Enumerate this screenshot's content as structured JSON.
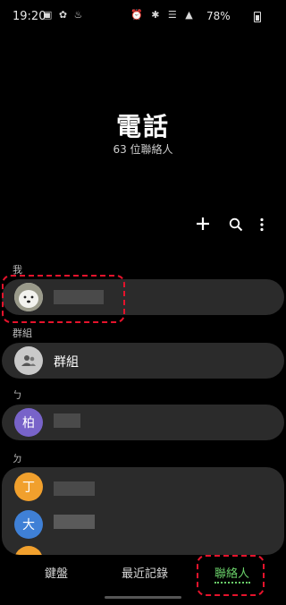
{
  "status_bar": {
    "time": "19:20",
    "left_icons": "▣ ✿ ♨",
    "right_icons": "⏰ ✱ ☰ ▲",
    "battery": "78%"
  },
  "header": {
    "title": "電話",
    "subtitle": "63 位聯絡人"
  },
  "toolbar": {
    "add_icon": "plus-icon",
    "search_icon": "search-icon",
    "more_icon": "more-vertical-icon"
  },
  "sections": {
    "me": "我",
    "groups": "群組",
    "letter_1": "ㄅ",
    "letter_2": "ㄉ"
  },
  "group_item": {
    "label": "群組"
  },
  "contacts": {
    "c1_initial": "柏",
    "c2_initial": "丁",
    "c3_initial": "大"
  },
  "colors": {
    "purple": "#7863c9",
    "orange": "#f1a02d",
    "blue": "#3f80d6",
    "accent_green": "#6bd16a",
    "annotation_red": "#e5132c"
  },
  "nav": {
    "keypad": "鍵盤",
    "recents": "最近記錄",
    "contacts": "聯絡人"
  }
}
